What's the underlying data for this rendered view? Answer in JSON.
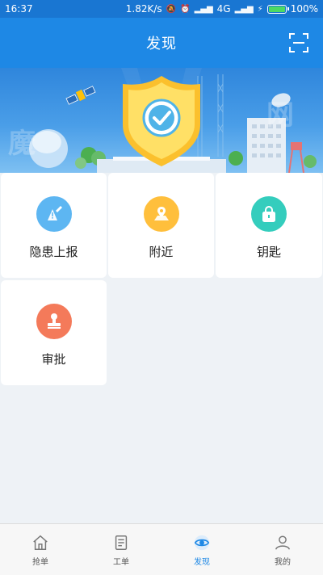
{
  "status_bar": {
    "time": "16:37",
    "speed": "1.82K/s",
    "network": "4G",
    "battery": "100%"
  },
  "header": {
    "title": "发现",
    "scan_icon": "scan-icon"
  },
  "tiles": [
    {
      "label": "隐患上报",
      "icon": "report-icon",
      "color": "#5db6f2"
    },
    {
      "label": "附近",
      "icon": "map-pin-icon",
      "color": "#ffbf3c"
    },
    {
      "label": "钥匙",
      "icon": "lock-icon",
      "color": "#34cdbd"
    },
    {
      "label": "审批",
      "icon": "stamp-icon",
      "color": "#f47a5a"
    }
  ],
  "bottom_nav": {
    "items": [
      {
        "label": "抢单",
        "icon": "home-icon"
      },
      {
        "label": "工单",
        "icon": "clipboard-icon"
      },
      {
        "label": "发现",
        "icon": "eye-icon",
        "active": true
      },
      {
        "label": "我的",
        "icon": "user-icon"
      }
    ]
  },
  "colors": {
    "primary": "#1e88e5",
    "statusbar": "#1976d2",
    "background": "#eef2f6"
  }
}
